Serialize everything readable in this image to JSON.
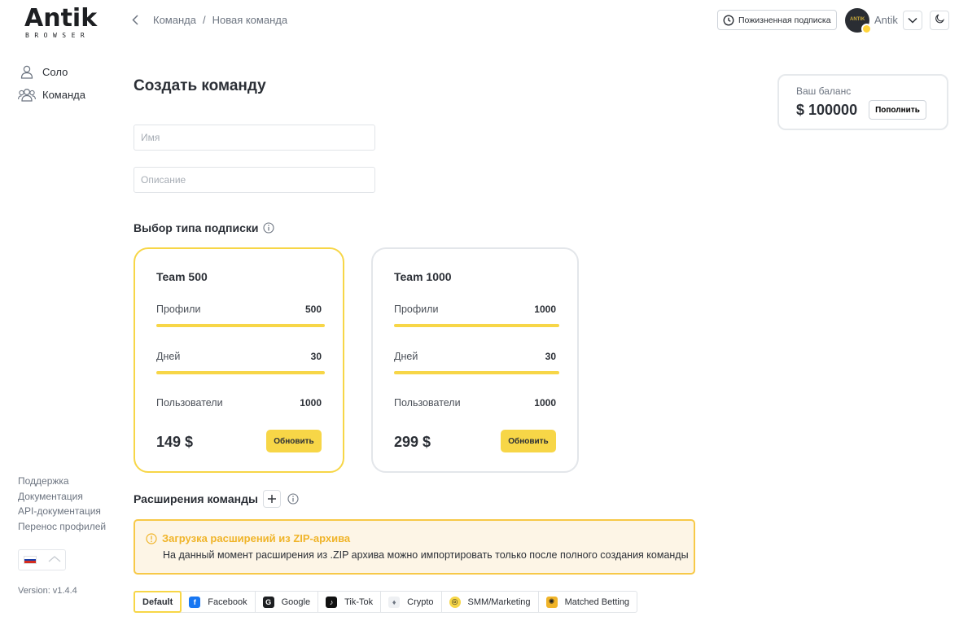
{
  "logo": {
    "word": "Antik",
    "sub": "BROWSER"
  },
  "sidebar": {
    "items": [
      {
        "label": "Соло",
        "icon": "user-icon"
      },
      {
        "label": "Команда",
        "icon": "users-icon"
      }
    ],
    "links": [
      "Поддержка",
      "Документация",
      "API-документация",
      "Перенос профилей"
    ],
    "version": "Version: v1.4.4"
  },
  "header": {
    "breadcrumb": [
      "Команда",
      "Новая команда"
    ],
    "subscription_label": "Пожизненная подписка",
    "user_name": "Antik"
  },
  "balance": {
    "label": "Ваш баланс",
    "value": "$ 100000",
    "topup_label": "Пополнить"
  },
  "main": {
    "title": "Создать команду",
    "name_placeholder": "Имя",
    "description_placeholder": "Описание",
    "plans_title": "Выбор типа подписки",
    "plans": [
      {
        "name": "Team 500",
        "rows": [
          {
            "label": "Профили",
            "value": "500"
          },
          {
            "label": "Дней",
            "value": "30"
          },
          {
            "label": "Пользователи",
            "value": "1000"
          }
        ],
        "price": "149 $",
        "button": "Обновить",
        "selected": true
      },
      {
        "name": "Team 1000",
        "rows": [
          {
            "label": "Профили",
            "value": "1000"
          },
          {
            "label": "Дней",
            "value": "30"
          },
          {
            "label": "Пользователи",
            "value": "1000"
          }
        ],
        "price": "299 $",
        "button": "Обновить",
        "selected": false
      }
    ],
    "extensions_title": "Расширения команды",
    "alert": {
      "title": "Загрузка расширений из ZIP-архива",
      "text": "На данный момент расширения из .ZIP архива можно импортировать только после полного создания команды"
    },
    "tabs": [
      {
        "label": "Default",
        "icon": ""
      },
      {
        "label": "Facebook",
        "icon": "facebook-icon"
      },
      {
        "label": "Google",
        "icon": "google-icon"
      },
      {
        "label": "Tik-Tok",
        "icon": "tiktok-icon"
      },
      {
        "label": "Crypto",
        "icon": "ethereum-icon"
      },
      {
        "label": "SMM/Marketing",
        "icon": "target-icon"
      },
      {
        "label": "Matched Betting",
        "icon": "betting-icon"
      }
    ]
  },
  "colors": {
    "accent": "#f7d647",
    "alert_bg": "#fdf5e6",
    "alert_title": "#f0b429"
  }
}
